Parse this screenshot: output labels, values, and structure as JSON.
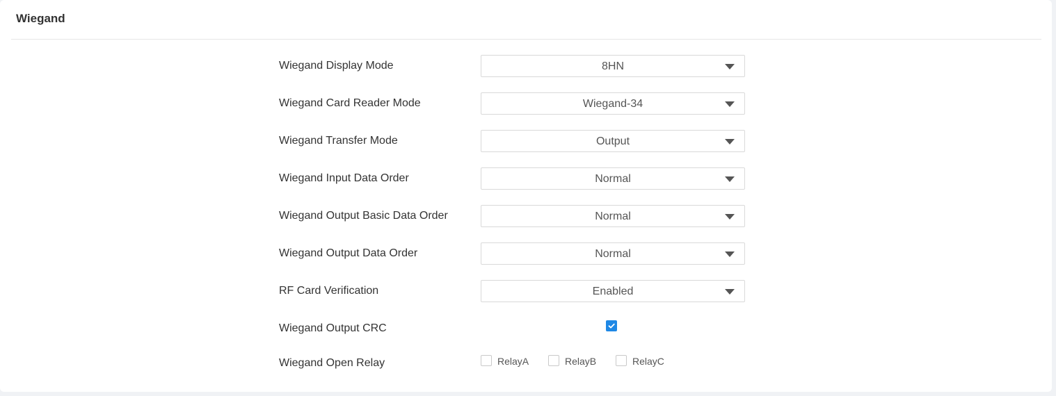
{
  "section": {
    "title": "Wiegand"
  },
  "settings": [
    {
      "label": "Wiegand Display Mode",
      "value": "8HN"
    },
    {
      "label": "Wiegand Card Reader Mode",
      "value": "Wiegand-34"
    },
    {
      "label": "Wiegand Transfer Mode",
      "value": "Output"
    },
    {
      "label": "Wiegand Input Data Order",
      "value": "Normal"
    },
    {
      "label": "Wiegand Output Basic Data Order",
      "value": "Normal"
    },
    {
      "label": "Wiegand Output Data Order",
      "value": "Normal"
    },
    {
      "label": "RF Card Verification",
      "value": "Enabled"
    }
  ],
  "output_crc": {
    "label": "Wiegand Output CRC",
    "checked": true
  },
  "open_relay": {
    "label": "Wiegand Open Relay",
    "options": [
      {
        "label": "RelayA",
        "checked": false
      },
      {
        "label": "RelayB",
        "checked": false
      },
      {
        "label": "RelayC",
        "checked": false
      }
    ]
  },
  "colors": {
    "accent": "#1e88e5",
    "page_background": "#f0f2f5",
    "card_background": "#ffffff"
  },
  "icons": {
    "select_arrow": "caret-down-icon",
    "checkbox_check": "checkmark-icon"
  }
}
